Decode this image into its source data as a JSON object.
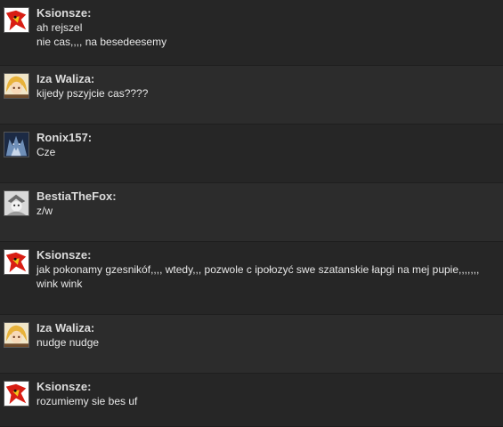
{
  "messages": [
    {
      "author": "Ksionsze:",
      "avatar_icon": "red-bird-icon",
      "lines": [
        "ah rejszel",
        "nie cas,,,, na besedeesemy"
      ]
    },
    {
      "author": "Iza Waliza:",
      "avatar_icon": "blonde-girl-icon",
      "lines": [
        "kijedy pszyjcie cas????"
      ]
    },
    {
      "author": "Ronix157:",
      "avatar_icon": "dark-creature-icon",
      "lines": [
        "Cze"
      ]
    },
    {
      "author": "BestiaTheFox:",
      "avatar_icon": "grey-figure-icon",
      "lines": [
        "z/w"
      ]
    },
    {
      "author": "Ksionsze:",
      "avatar_icon": "red-bird-icon",
      "lines": [
        "jak pokonamy gzesnikóf,,,, wtedy,,, pozwole c ipołozyć swe szatanskie łapgi na mej pupie,,,,,,,",
        "wink wink"
      ]
    },
    {
      "author": "Iza Waliza:",
      "avatar_icon": "blonde-girl-icon",
      "lines": [
        "nudge nudge"
      ]
    },
    {
      "author": "Ksionsze:",
      "avatar_icon": "red-bird-icon",
      "lines": [
        "rozumiemy sie bes uf"
      ]
    }
  ]
}
